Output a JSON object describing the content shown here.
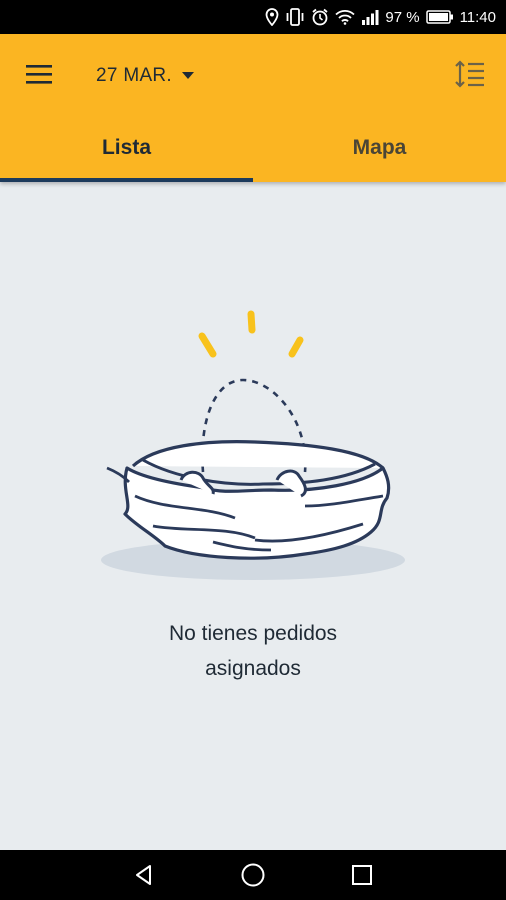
{
  "status_bar": {
    "battery_percent": "97 %",
    "time": "11:40",
    "icons": [
      "location-icon",
      "vibrate-icon",
      "alarm-icon",
      "wifi-icon",
      "signal-icon",
      "battery-icon"
    ]
  },
  "header": {
    "menu_icon": "menu-icon",
    "date": "27 MAR.",
    "dropdown_icon": "caret-down-icon",
    "sort_icon": "sort-icon"
  },
  "tabs": [
    {
      "label": "Lista",
      "selected": true
    },
    {
      "label": "Mapa",
      "selected": false
    }
  ],
  "empty_state": {
    "illustration": "empty-nest-illustration",
    "line1": "No tienes pedidos",
    "line2": "asignados"
  },
  "nav_bar": {
    "icons": [
      "back-icon",
      "home-icon",
      "recents-icon"
    ]
  },
  "colors": {
    "app_bar": "#fbb522",
    "tab_indicator": "#1d3b5c",
    "background": "#e8ecef",
    "text_dark": "#1f2a35",
    "accent_yellow": "#f8c21c"
  }
}
